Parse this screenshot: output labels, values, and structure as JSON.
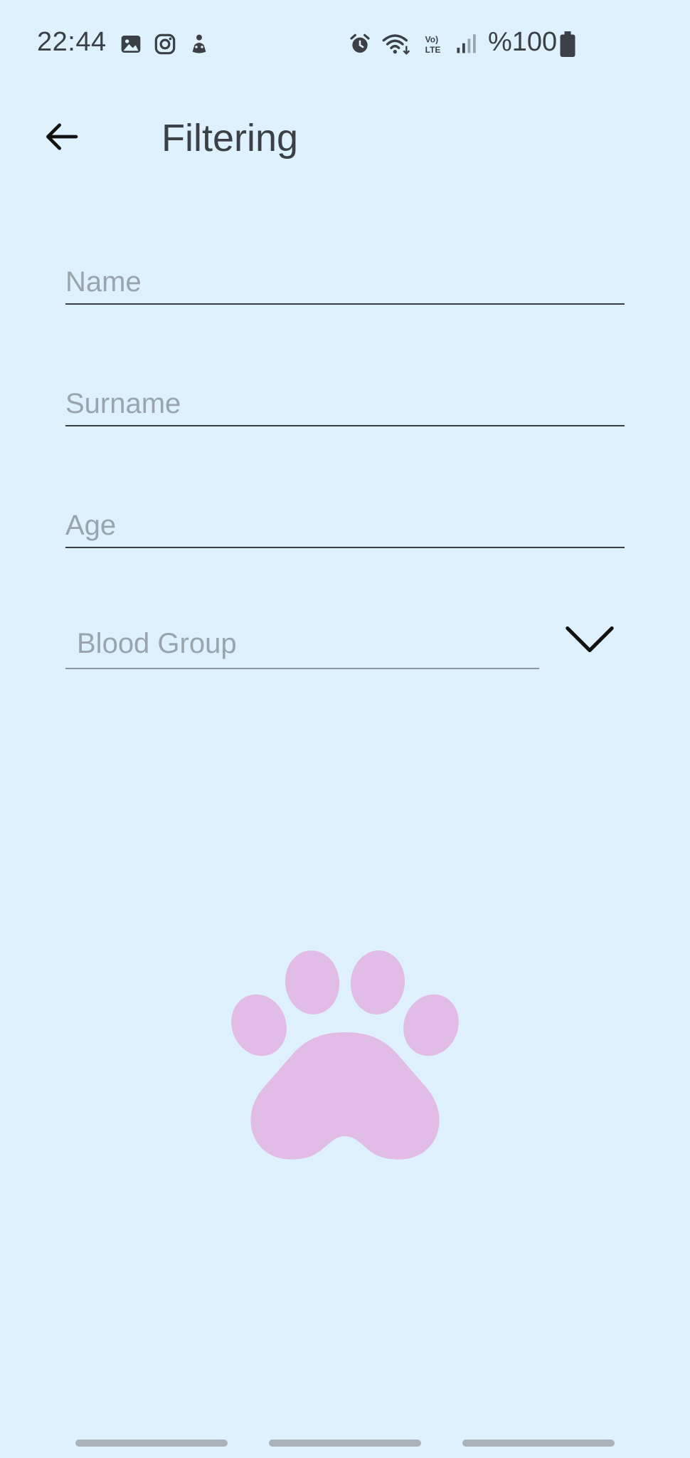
{
  "status_bar": {
    "time": "22:44",
    "battery": "%100",
    "left_icons": [
      "gallery-icon",
      "instagram-icon",
      "app-notification-icon"
    ],
    "right_icons": [
      "alarm-icon",
      "wifi-icon",
      "volte-icon",
      "signal-icon",
      "battery-icon"
    ]
  },
  "app_bar": {
    "title": "Filtering"
  },
  "form": {
    "name_placeholder": "Name",
    "surname_placeholder": "Surname",
    "age_placeholder": "Age",
    "blood_group_label": "Blood Group"
  },
  "colors": {
    "background": "#dff1fc",
    "paw": "#e0bce6",
    "text": "#3b3f46",
    "placeholder": "#9aa4ad"
  },
  "decoration": {
    "paw_icon": "paw-icon"
  }
}
